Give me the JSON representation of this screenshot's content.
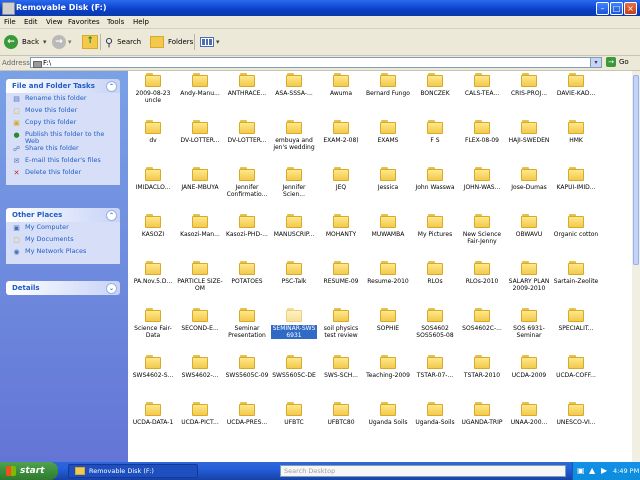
{
  "window": {
    "title": "Removable Disk (F:)",
    "min_icon": "minimize-icon",
    "max_icon": "maximize-icon",
    "close_icon": "close-icon"
  },
  "menu": [
    "File",
    "Edit",
    "View",
    "Favorites",
    "Tools",
    "Help"
  ],
  "toolbar": {
    "back_label": "Back",
    "search_label": "Search",
    "folders_label": "Folders"
  },
  "address": {
    "label": "Address",
    "value": "F:\\",
    "go_label": "Go"
  },
  "sidebar": {
    "tasks": {
      "title": "File and Folder Tasks",
      "items": [
        "Rename this folder",
        "Move this folder",
        "Copy this folder",
        "Publish this folder to the Web",
        "Share this folder",
        "E-mail this folder's files",
        "Delete this folder"
      ]
    },
    "places": {
      "title": "Other Places",
      "items": [
        "My Computer",
        "My Documents",
        "My Network Places"
      ]
    },
    "details": {
      "title": "Details"
    }
  },
  "folders": [
    [
      "2009-08-23 uncle",
      "Andy-Manu...",
      "ANTHRACE...",
      "ASA-SSSA-...",
      "Awuma",
      "Bernard Fungo",
      "BONCZEK",
      "CALS-TEA...",
      "CRIS-PROJ...",
      "DAVIE-KAD..."
    ],
    [
      "dv",
      "DV-LOTTER...",
      "DV-LOTTER...",
      "embuya and jen's wedding",
      "EXAM-2-08)",
      "EXAMS",
      "F S",
      "FLEX-08-09",
      "HAJI-SWEDEN",
      "HMK"
    ],
    [
      "IMIDACLO...",
      "JANE-MBUYA",
      "Jennifer Confirmatio...",
      "Jennifer Scien...",
      "JEQ",
      "Jessica",
      "John Wasswa",
      "JOHN-WAS...",
      "Jose-Dumas",
      "KAPUI-IMID..."
    ],
    [
      "KASOZI",
      "Kasozi-Man...",
      "Kasozi-PHD-...",
      "MANUSCRIP...",
      "MOHANTY",
      "MUWAMBA",
      "My Pictures",
      "New Science Fair-Jenny",
      "OBWAVU",
      "Organic cotton"
    ],
    [
      "PA.Nov.5.D...",
      "PARTICLE SIZE-OM",
      "POTATOES",
      "PSC-Talk",
      "RESUME-09",
      "Resume-2010",
      "RLOs",
      "RLOs-2010",
      "SALARY PLAN 2009-2010",
      "Sartain-Zeolite"
    ],
    [
      "Science Fair-Data",
      "SECOND-E...",
      "Seminar Presentation",
      "SEMINAR-SWS 6931",
      "soil physics test review",
      "SOPHIE",
      "SOS4602 SOS5605-08",
      "SOS4602C-...",
      "SOS 6931-Seminar",
      "SPECIALIT..."
    ],
    [
      "SWS4602-S...",
      "SWS4602-...",
      "SWS5605C-09",
      "SWS5605C-DE",
      "SWS-SCH...",
      "Teaching-2009",
      "TSTAR-07-...",
      "TSTAR-2010",
      "UCDA-2009",
      "UCDA-COFF..."
    ],
    [
      "UCDA-DATA-1",
      "UCDA-PICT...",
      "UCDA-PRES...",
      "UFBTC",
      "UFBTC80",
      "Uganda Soils",
      "Uganda-Soils",
      "UGANDA-TRIP",
      "UNAA-200...",
      "UNESCO-VI..."
    ]
  ],
  "selected": "SEMINAR-SWS 6931",
  "taskbar": {
    "start_label": "start",
    "window_label": "Removable Disk (F:)",
    "search_placeholder": "Search Desktop",
    "clock": "4:49 PM"
  }
}
